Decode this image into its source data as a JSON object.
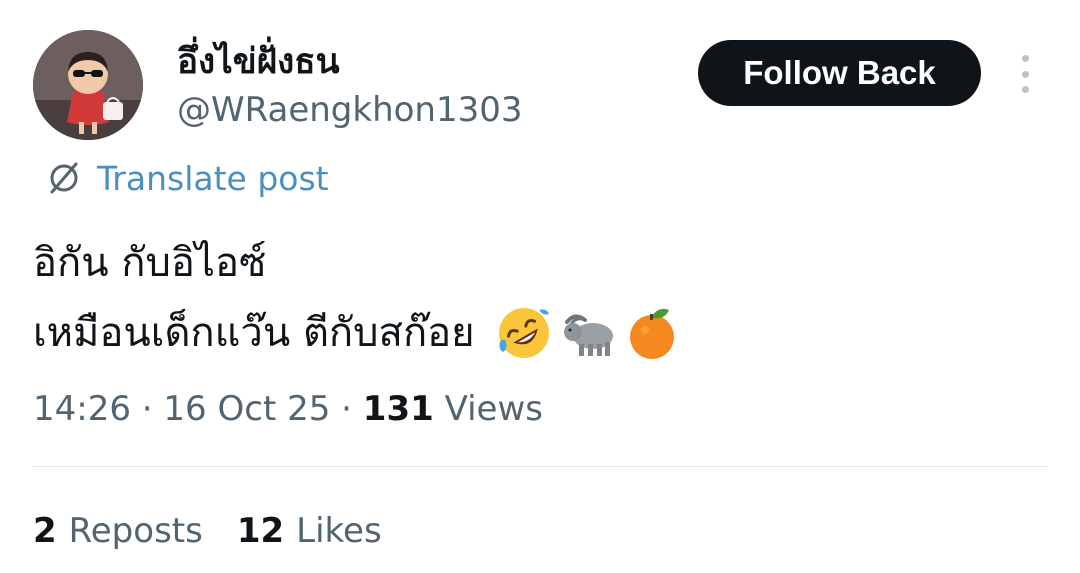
{
  "user": {
    "display_name": "อึ่งไข่ฝั่งธน",
    "handle": "@WRaengkhon1303",
    "avatar_icon": "profile-avatar-cartoon-girl-with-sunglasses"
  },
  "actions": {
    "follow_label": "Follow Back",
    "more_icon": "vertical-ellipsis-icon"
  },
  "translate": {
    "label": "Translate post",
    "icon": "translate-globe-icon"
  },
  "post": {
    "line1": "อิกัน กับอิไอซ์",
    "line2": "เหมือนเด็กแว๊น ตีกับสก๊อย",
    "emojis": [
      "rolling-on-floor-laughing-emoji",
      "water-buffalo-emoji",
      "tangerine-emoji"
    ]
  },
  "meta": {
    "time": "14:26",
    "date": "16 Oct 25",
    "separator": "·",
    "views_count": "131",
    "views_label": "Views"
  },
  "stats": {
    "reposts_count": "2",
    "reposts_label": "Reposts",
    "likes_count": "12",
    "likes_label": "Likes"
  },
  "colors": {
    "follow_bg": "#0f1419",
    "secondary_text": "#536471",
    "link": "#4a8fc2"
  }
}
